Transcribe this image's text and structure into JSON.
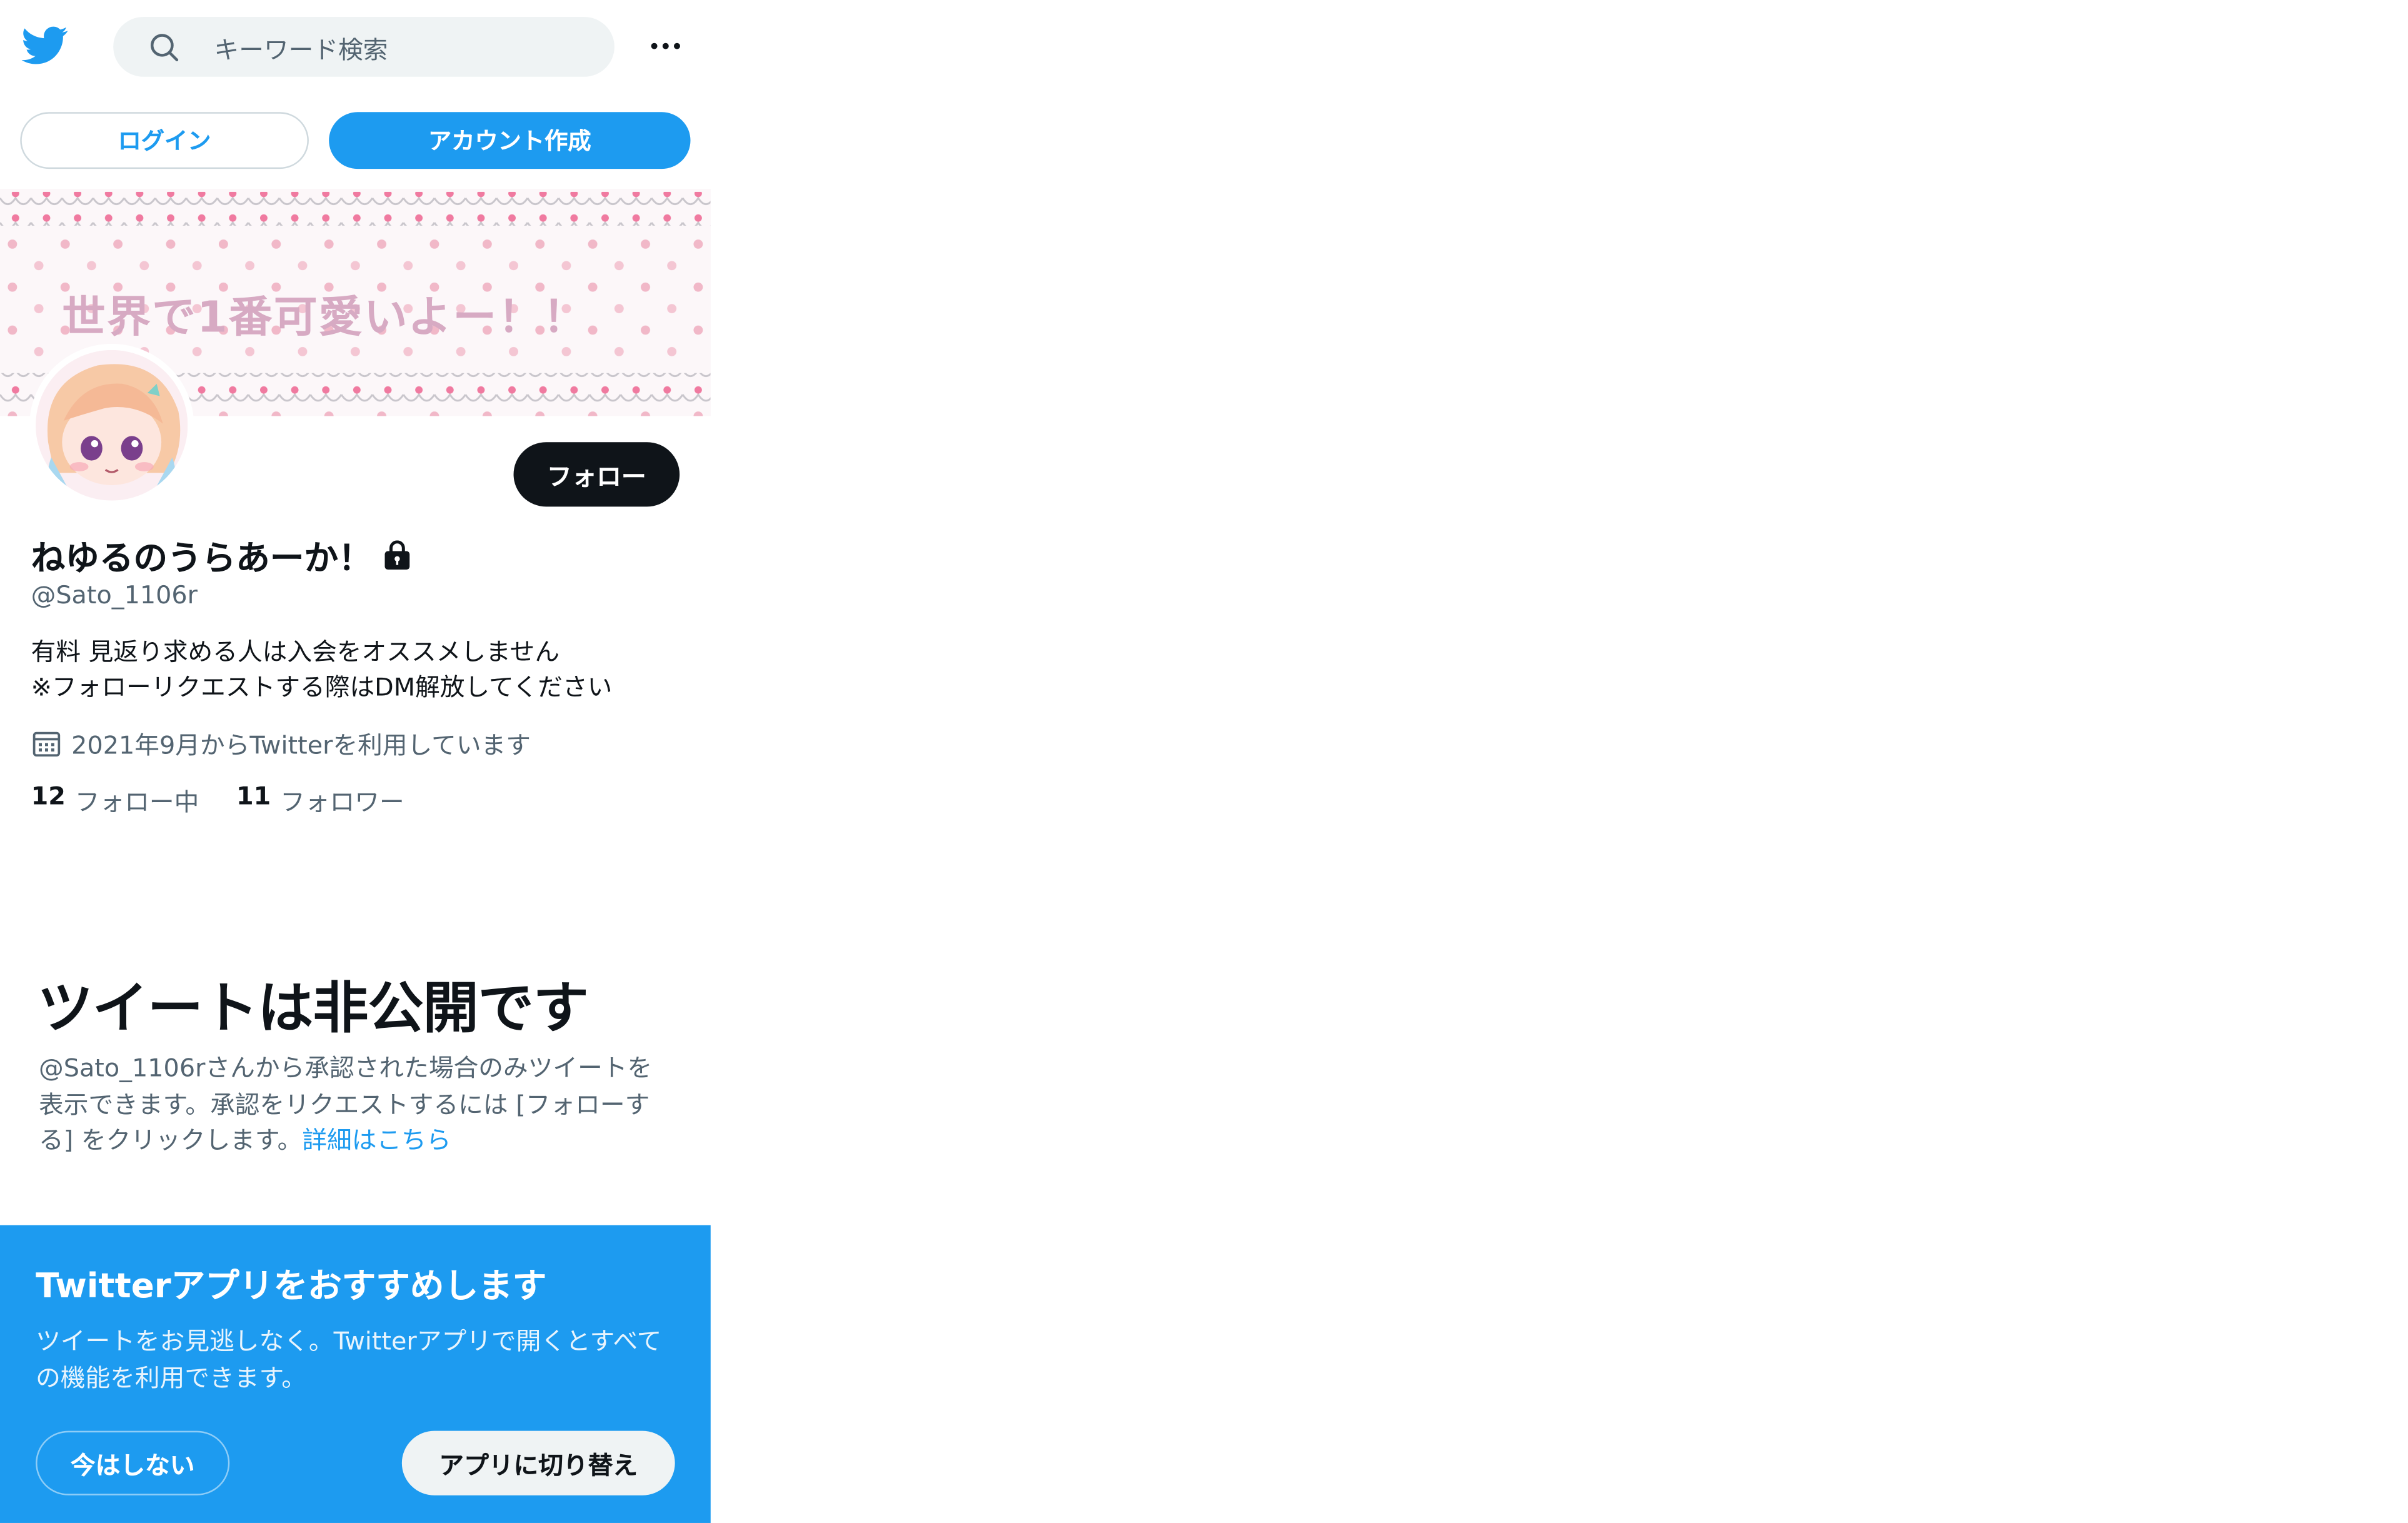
{
  "header": {
    "logo_icon": "twitter-bird-icon",
    "search_placeholder": "キーワード検索",
    "more_icon": "more-horizontal-icon"
  },
  "auth": {
    "login_label": "ログイン",
    "signup_label": "アカウント作成"
  },
  "banner": {
    "text": "世界で1番可愛いよー！！"
  },
  "profile": {
    "follow_label": "フォロー",
    "name": "ねゆるのうらあーか！",
    "handle": "@Sato_1106r",
    "bio_line1": "有料 見返り求める人は入会をオススメしません",
    "bio_line2": "※フォローリクエストする際はDM解放してください",
    "joined": "2021年9月からTwitterを利用しています",
    "following_count": "12",
    "following_label": "フォロー中",
    "followers_count": "11",
    "followers_label": "フォロワー"
  },
  "protected": {
    "title": "ツイートは非公開です",
    "description": "@Sato_1106rさんから承認された場合のみツイートを表示できます。承認をリクエストするには [フォローする] をクリックします。",
    "link": "詳細はこちら"
  },
  "promo": {
    "title": "Twitterアプリをおすすめします",
    "description": "ツイートをお見逃しなく。Twitterアプリで開くとすべての機能を利用できます。",
    "not_now_label": "今はしない",
    "switch_label": "アプリに切り替え"
  },
  "colors": {
    "brand": "#1d9bf0",
    "text_primary": "#0f1419",
    "text_secondary": "#536471",
    "search_bg": "#eff3f4"
  }
}
